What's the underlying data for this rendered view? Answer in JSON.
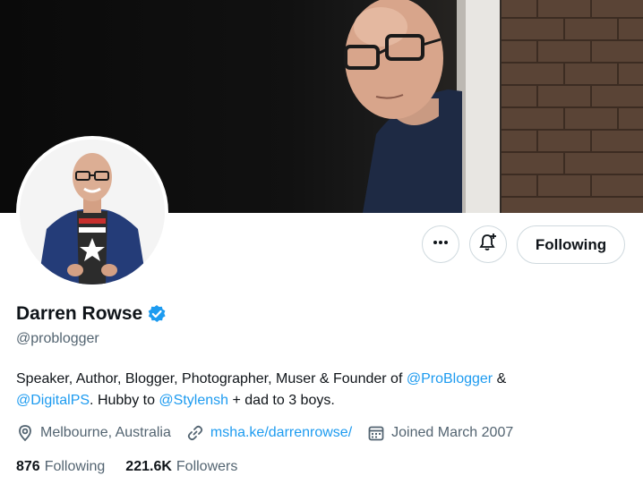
{
  "profile": {
    "display_name": "Darren Rowse",
    "handle": "@problogger",
    "verified": true
  },
  "actions": {
    "more_label": "More",
    "notify_label": "Notifications",
    "following_label": "Following"
  },
  "bio": {
    "part1": "Speaker, Author, Blogger, Photographer, Muser & Founder of ",
    "mention1": "@ProBlogger",
    "part2": " &",
    "mention2": "@DigitalPS",
    "part3": ". Hubby to ",
    "mention3": "@Stylensh",
    "part4": " + dad to 3 boys."
  },
  "meta": {
    "location": "Melbourne, Australia",
    "website": "msha.ke/darrenrowse/",
    "joined": "Joined March 2007"
  },
  "stats": {
    "following_count": "876",
    "following_label": "Following",
    "followers_count": "221.6K",
    "followers_label": "Followers"
  },
  "colors": {
    "accent": "#1d9bf0",
    "text_primary": "#0f1419",
    "text_secondary": "#536471",
    "border": "#cfd9de"
  },
  "icons": {
    "more": "more-dots-icon",
    "notify": "bell-plus-icon",
    "verified": "verified-badge-icon",
    "location": "location-pin-icon",
    "link": "link-icon",
    "calendar": "calendar-icon"
  }
}
